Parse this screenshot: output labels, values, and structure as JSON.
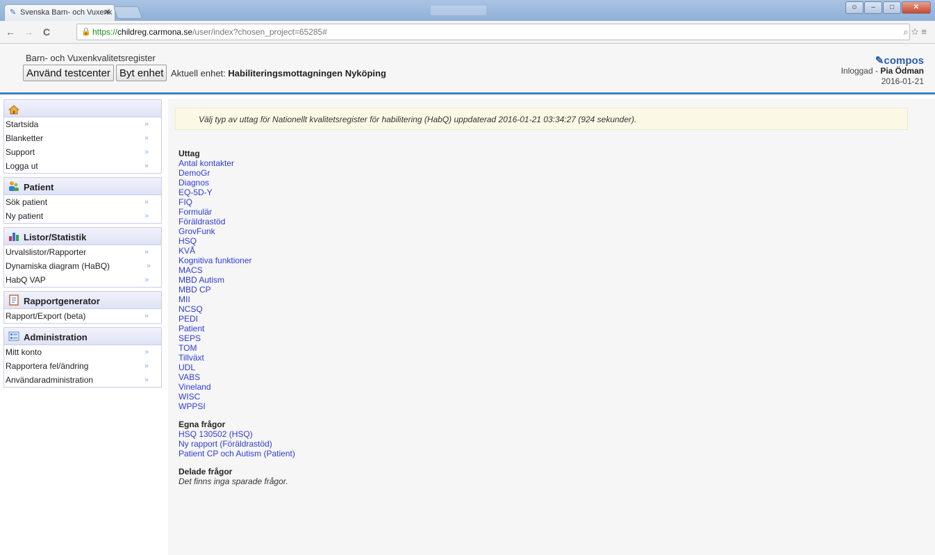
{
  "browser": {
    "tab_title": "Svenska Barn- och Vuxenk",
    "url_https": "https://",
    "url_host": "childreg.carmona.se",
    "url_path": "/user/index?chosen_project=65285#"
  },
  "header": {
    "register_title": "Barn- och Vuxenkvalitetsregister",
    "testcenter_button": "Använd testcenter",
    "byt_enhet_button": "Byt enhet",
    "aktuell_enhet_label": "Aktuell enhet:",
    "aktuell_enhet_value": "Habiliteringsmottagningen Nyköping",
    "logo": "compos",
    "inloggad_label": "Inloggad -",
    "user_name": "Pia Ödman",
    "date": "2016-01-21"
  },
  "sidebar": {
    "home": [
      "Startsida",
      "Blanketter",
      "Support",
      "Logga ut"
    ],
    "patient_title": "Patient",
    "patient": [
      "Sök patient",
      "Ny patient"
    ],
    "listor_title": "Listor/Statistik",
    "listor": [
      "Urvalslistor/Rapporter",
      "Dynamiska diagram (HaBQ)",
      "HabQ VAP"
    ],
    "rapport_title": "Rapportgenerator",
    "rapport": [
      "Rapport/Export (beta)"
    ],
    "admin_title": "Administration",
    "admin": [
      "Mitt konto",
      "Rapportera fel/ändring",
      "Användaradministration"
    ],
    "chevron": "»"
  },
  "main": {
    "notice": "Välj typ av uttag för Nationellt kvalitetsregister för habilitering (HabQ) uppdaterad 2016-01-21 03:34:27 (924 sekunder).",
    "uttag_title": "Uttag",
    "uttag": [
      "Antal kontakter",
      "DemoGr",
      "Diagnos",
      "EQ-5D-Y",
      "FIQ",
      "Formulär",
      "Föräldrastöd",
      "GrovFunk",
      "HSQ",
      "KVÅ",
      "Kognitiva funktioner",
      "MACS",
      "MBD Autism",
      "MBD CP",
      "MII",
      "NCSQ",
      "PEDI",
      "Patient",
      "SEPS",
      "TOM",
      "Tillväxt",
      "UDL",
      "VABS",
      "Vineland",
      "WISC",
      "WPPSI"
    ],
    "egna_title": "Egna frågor",
    "egna": [
      "HSQ 130502 (HSQ)",
      "Ny rapport (Föräldrastöd)",
      "Patient CP och Autism (Patient)"
    ],
    "delade_title": "Delade frågor",
    "delade_empty": "Det finns inga sparade frågor."
  }
}
